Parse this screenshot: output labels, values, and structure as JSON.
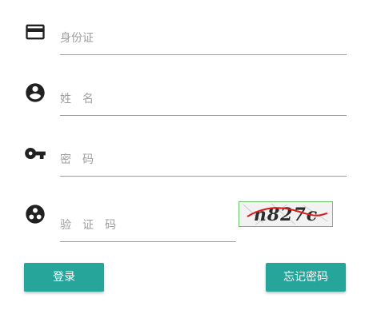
{
  "form": {
    "id_card": {
      "icon": "credit-card-icon",
      "placeholder": "身份证"
    },
    "name": {
      "icon": "account-circle-icon",
      "placeholder": "姓　名"
    },
    "password": {
      "icon": "key-icon",
      "placeholder": "密　码"
    },
    "captcha": {
      "icon": "captcha-face-icon",
      "placeholder": "验　证　码",
      "image_text": "n827c"
    }
  },
  "buttons": {
    "login_label": "登录",
    "forgot_label": "忘记密码"
  },
  "colors": {
    "accent": "#26a69a",
    "icon": "#212121",
    "underline": "#9e9e9e",
    "placeholder": "#9e9e9e",
    "captcha_border": "#6abf6a"
  }
}
